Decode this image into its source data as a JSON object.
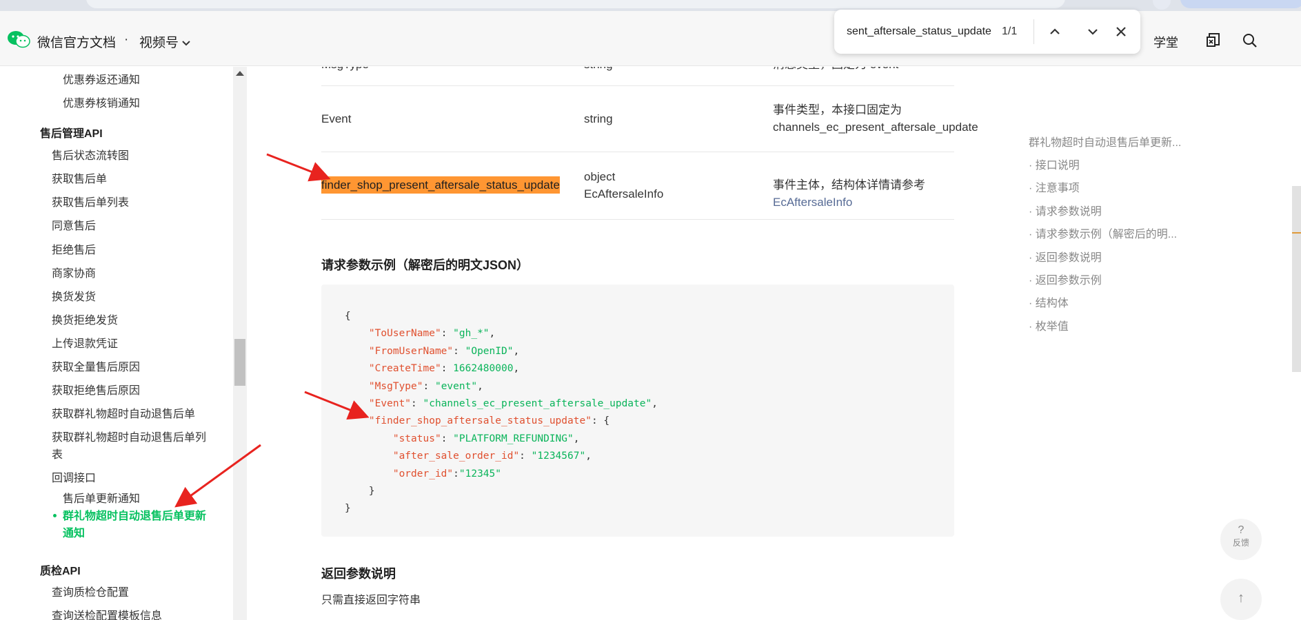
{
  "nav": {
    "brand": "微信官方文档",
    "separator": "·",
    "channel": "视频号",
    "xuetang": "学堂"
  },
  "find": {
    "query": "sent_aftersale_status_update",
    "count": "1/1"
  },
  "sidebar": {
    "items": [
      {
        "label": "优惠券返还通知",
        "kind": "sub2"
      },
      {
        "label": "优惠券核销通知",
        "kind": "sub2"
      },
      {
        "label": "售后管理API",
        "kind": "head"
      },
      {
        "label": "售后状态流转图",
        "kind": "sub"
      },
      {
        "label": "获取售后单",
        "kind": "sub"
      },
      {
        "label": "获取售后单列表",
        "kind": "sub"
      },
      {
        "label": "同意售后",
        "kind": "sub"
      },
      {
        "label": "拒绝售后",
        "kind": "sub"
      },
      {
        "label": "商家协商",
        "kind": "sub"
      },
      {
        "label": "换货发货",
        "kind": "sub"
      },
      {
        "label": "换货拒绝发货",
        "kind": "sub"
      },
      {
        "label": "上传退款凭证",
        "kind": "sub"
      },
      {
        "label": "获取全量售后原因",
        "kind": "sub"
      },
      {
        "label": "获取拒绝售后原因",
        "kind": "sub"
      },
      {
        "label": "获取群礼物超时自动退售后单",
        "kind": "sub"
      },
      {
        "label": "获取群礼物超时自动退售后单列",
        "kind": "sub"
      },
      {
        "label": "表",
        "kind": "sub"
      },
      {
        "label": "回调接口",
        "kind": "sub"
      },
      {
        "label": "售后单更新通知",
        "kind": "sub2"
      },
      {
        "label": "质检API",
        "kind": "head"
      },
      {
        "label": "查询质检仓配置",
        "kind": "sub"
      },
      {
        "label": "查询送检配置模板信息",
        "kind": "sub"
      }
    ],
    "active": {
      "line1": "群礼物超时自动退售后单更新",
      "line2": "通知"
    }
  },
  "table": {
    "row0": {
      "name": "MsgType",
      "type": "string",
      "desc": "消息类型，固定为 event"
    },
    "row1": {
      "name": "Event",
      "type": "string",
      "desc1": "事件类型，本接口固定为",
      "desc2": "channels_ec_present_aftersale_update"
    },
    "row2": {
      "name": "finder_shop_present_aftersale_status_update",
      "type1": "object",
      "type2": "EcAftersaleInfo",
      "desc": "事件主体，结构体详情请参考",
      "link": "EcAftersaleInfo"
    }
  },
  "section_example": "请求参数示例（解密后的明文JSON）",
  "code": {
    "open": "{",
    "l1k": "\"ToUserName\"",
    "l1v": "\"gh_*\"",
    "l2k": "\"FromUserName\"",
    "l2v": "\"OpenID\"",
    "l3k": "\"CreateTime\"",
    "l3v": "1662480000",
    "l4k": "\"MsgType\"",
    "l4v": "\"event\"",
    "l5k": "\"Event\"",
    "l5v": "\"channels_ec_present_aftersale_update\"",
    "l6k": "\"finder_shop_aftersale_status_update\"",
    "l7k": "\"status\"",
    "l7v": "\"PLATFORM_REFUNDING\"",
    "l8k": "\"after_sale_order_id\"",
    "l8v": "\"1234567\"",
    "l9k": "\"order_id\"",
    "l9v": "\"12345\"",
    "innerclose": "}",
    "close": "}"
  },
  "section_return": "返回参数说明",
  "return_text": "只需直接返回字符串",
  "toc": [
    "群礼物超时自动退售后单更新...",
    "· 接口说明",
    "· 注意事项",
    "· 请求参数说明",
    "· 请求参数示例（解密后的明...",
    "· 返回参数说明",
    "· 返回参数示例",
    "· 结构体",
    "· 枚举值"
  ],
  "fab": {
    "feedback_q": "?",
    "feedback_label": "反馈",
    "top_arrow": "↑"
  },
  "colors": {
    "accent_green": "#07c160",
    "highlight": "#ff9632",
    "link": "#576b95",
    "arrow_red": "#e8231f"
  }
}
